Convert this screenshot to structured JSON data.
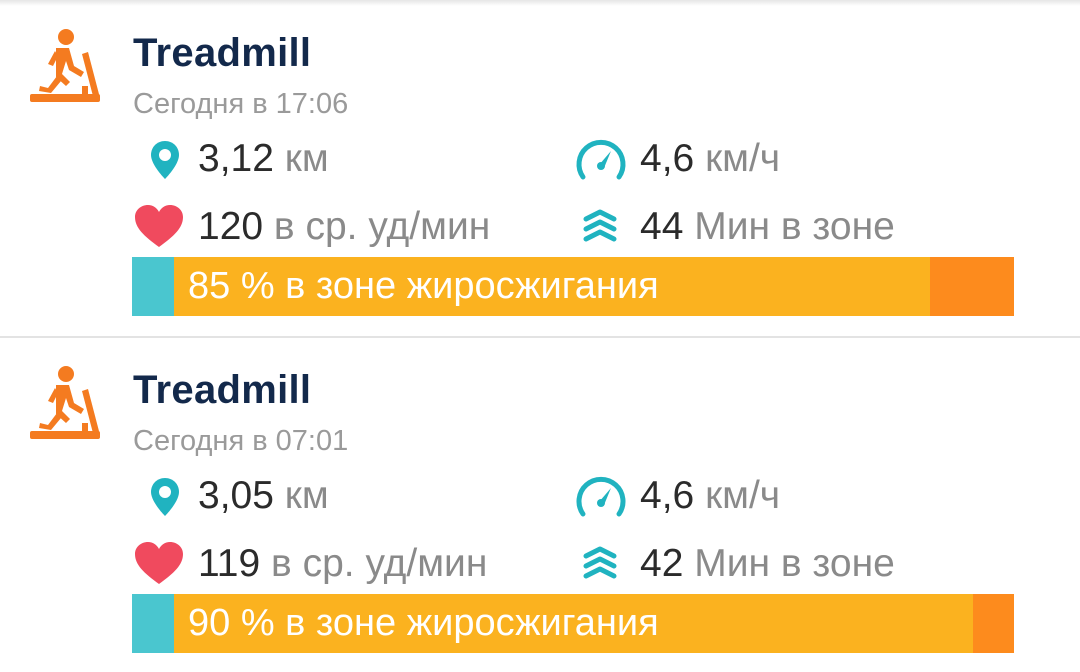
{
  "activities": [
    {
      "title": "Treadmill",
      "time": "Сегодня в 17:06",
      "distance_value": "3,12",
      "distance_unit": "км",
      "speed_value": "4,6",
      "speed_unit": "км/ч",
      "heart_value": "120",
      "heart_unit": "в ср. уд/мин",
      "zone_minutes_value": "44",
      "zone_minutes_unit": "Мин в зоне",
      "zone_text": "85 % в зоне жиросжигания",
      "zone_split": {
        "low": 0.048,
        "fat_burn": 0.86,
        "peak": 0.095
      }
    },
    {
      "title": "Treadmill",
      "time": "Сегодня в 07:01",
      "distance_value": "3,05",
      "distance_unit": "км",
      "speed_value": "4,6",
      "speed_unit": "км/ч",
      "heart_value": "119",
      "heart_unit": "в ср. уд/мин",
      "zone_minutes_value": "42",
      "zone_minutes_unit": "Мин в зоне",
      "zone_text": "90 % в зоне жиросжигания",
      "zone_split": {
        "low": 0.048,
        "fat_burn": 0.905,
        "peak": 0.047
      }
    }
  ],
  "colors": {
    "activity_icon": "#f47b20",
    "title": "#13294b",
    "accent_teal": "#20b3c0",
    "heart": "#f04a5e",
    "zone_low": "#4ac6cf",
    "zone_fat_burn": "#fbb21f",
    "zone_peak": "#fd8b1d"
  },
  "icons": {
    "activity": "treadmill-icon",
    "distance": "location-pin-icon",
    "speed": "speedometer-icon",
    "heart": "heart-icon",
    "zone": "zone-waves-icon"
  }
}
